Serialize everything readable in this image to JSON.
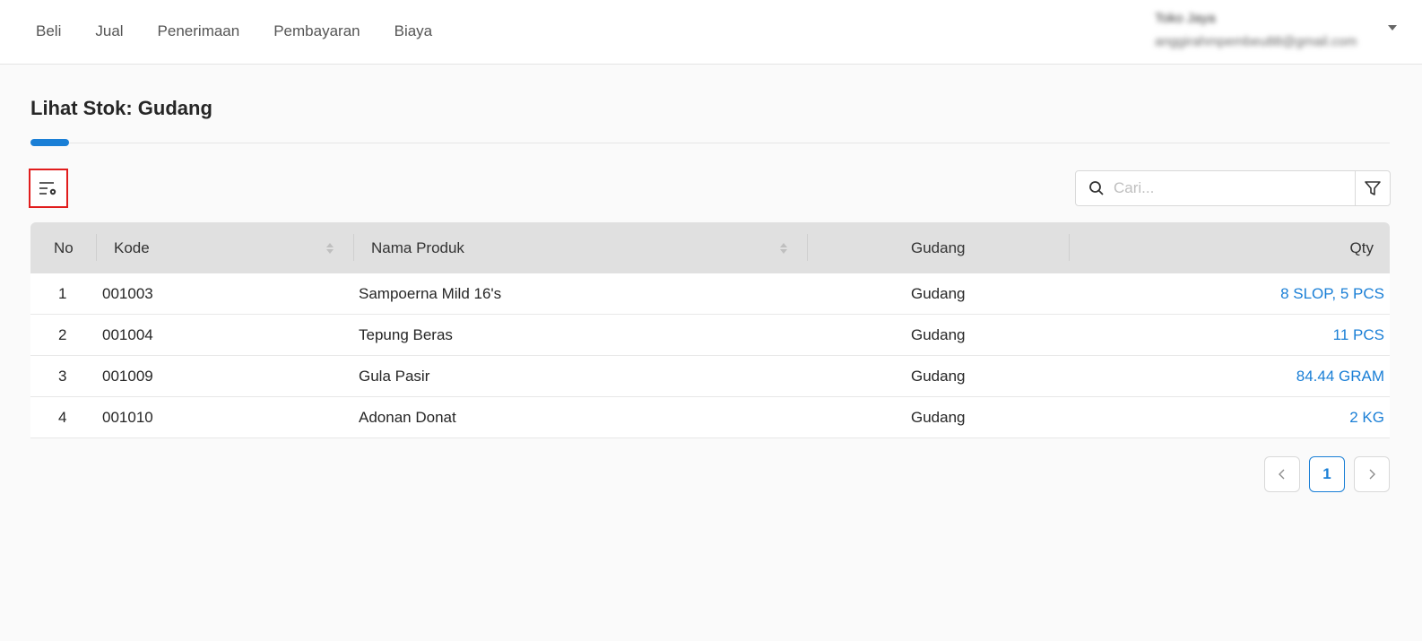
{
  "nav": {
    "items": [
      "Beli",
      "Jual",
      "Penerimaan",
      "Pembayaran",
      "Biaya"
    ]
  },
  "user": {
    "name": "Toko Jaya",
    "email": "anggirahmpembeu88@gmail.com"
  },
  "page": {
    "title": "Lihat Stok: Gudang"
  },
  "search": {
    "placeholder": "Cari..."
  },
  "table": {
    "headers": {
      "no": "No",
      "kode": "Kode",
      "nama": "Nama Produk",
      "gudang": "Gudang",
      "qty": "Qty"
    },
    "rows": [
      {
        "no": "1",
        "kode": "001003",
        "nama": "Sampoerna Mild 16's",
        "gudang": "Gudang",
        "qty": "8 SLOP, 5 PCS"
      },
      {
        "no": "2",
        "kode": "001004",
        "nama": "Tepung Beras",
        "gudang": "Gudang",
        "qty": "11 PCS"
      },
      {
        "no": "3",
        "kode": "001009",
        "nama": "Gula Pasir",
        "gudang": "Gudang",
        "qty": "84.44 GRAM"
      },
      {
        "no": "4",
        "kode": "001010",
        "nama": "Adonan Donat",
        "gudang": "Gudang",
        "qty": "2 KG"
      }
    ]
  },
  "pagination": {
    "current_page": "1"
  },
  "colors": {
    "accent": "#1a7fd6",
    "highlight_border": "#e11d1d",
    "header_bg": "#e0e0e0"
  }
}
